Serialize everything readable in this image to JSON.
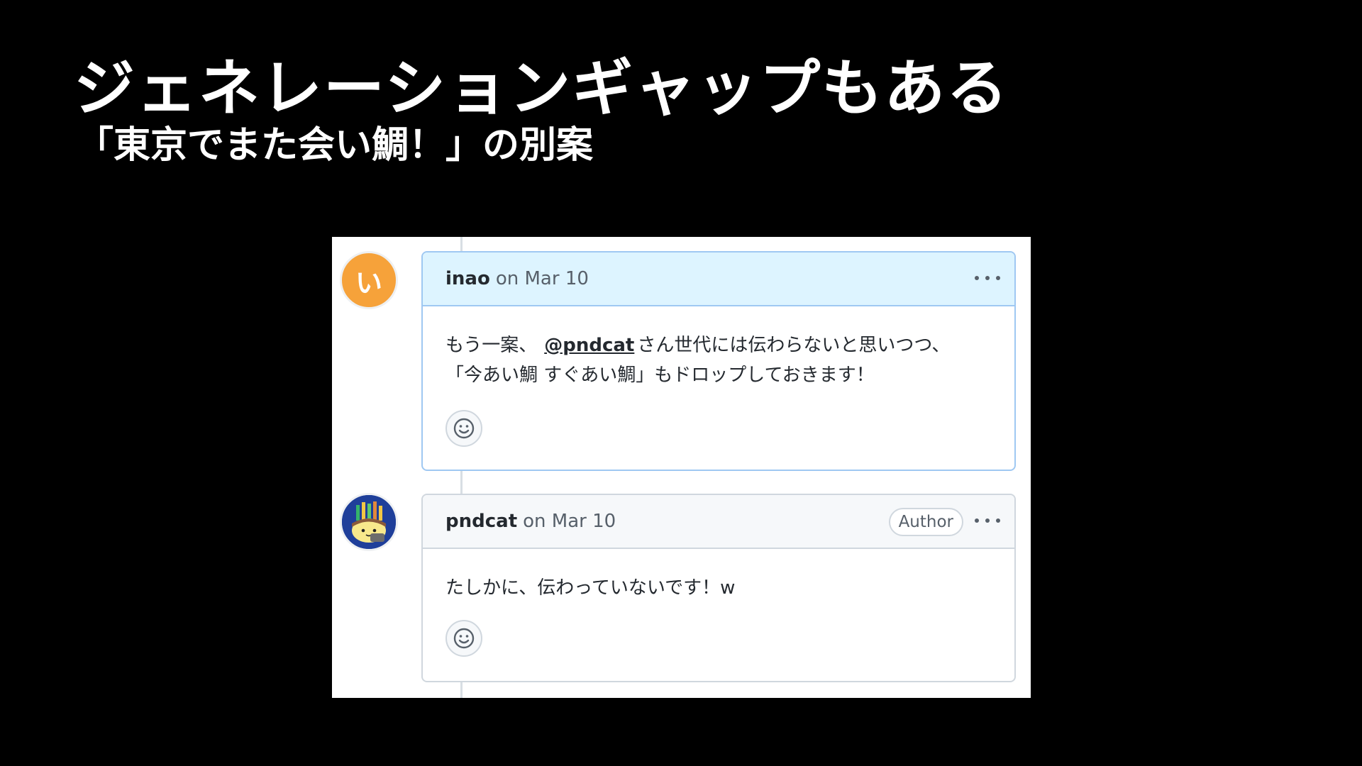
{
  "slide": {
    "title": "ジェネレーションギャップもある",
    "subtitle": "「東京でまた会い鯛！」の別案"
  },
  "comments": [
    {
      "avatar_text": "い",
      "author": "inao",
      "date": "on Mar 10",
      "body_line1_before": "もう一案、",
      "mention": "@pndcat",
      "body_line1_after": "さん世代には伝わらないと思いつつ、",
      "body_line2": "「今あい鯛 すぐあい鯛」もドロップしておきます！",
      "avatar_color": "#f6a23a",
      "header_color": "#ddf4ff"
    },
    {
      "author": "pndcat",
      "date": "on Mar 10",
      "badge": "Author",
      "body_line1": "たしかに、伝わっていないです！w",
      "header_color": "#f6f8fa"
    }
  ],
  "icons": {
    "more": "kebab-horizontal-icon",
    "reaction": "smiley-icon"
  }
}
